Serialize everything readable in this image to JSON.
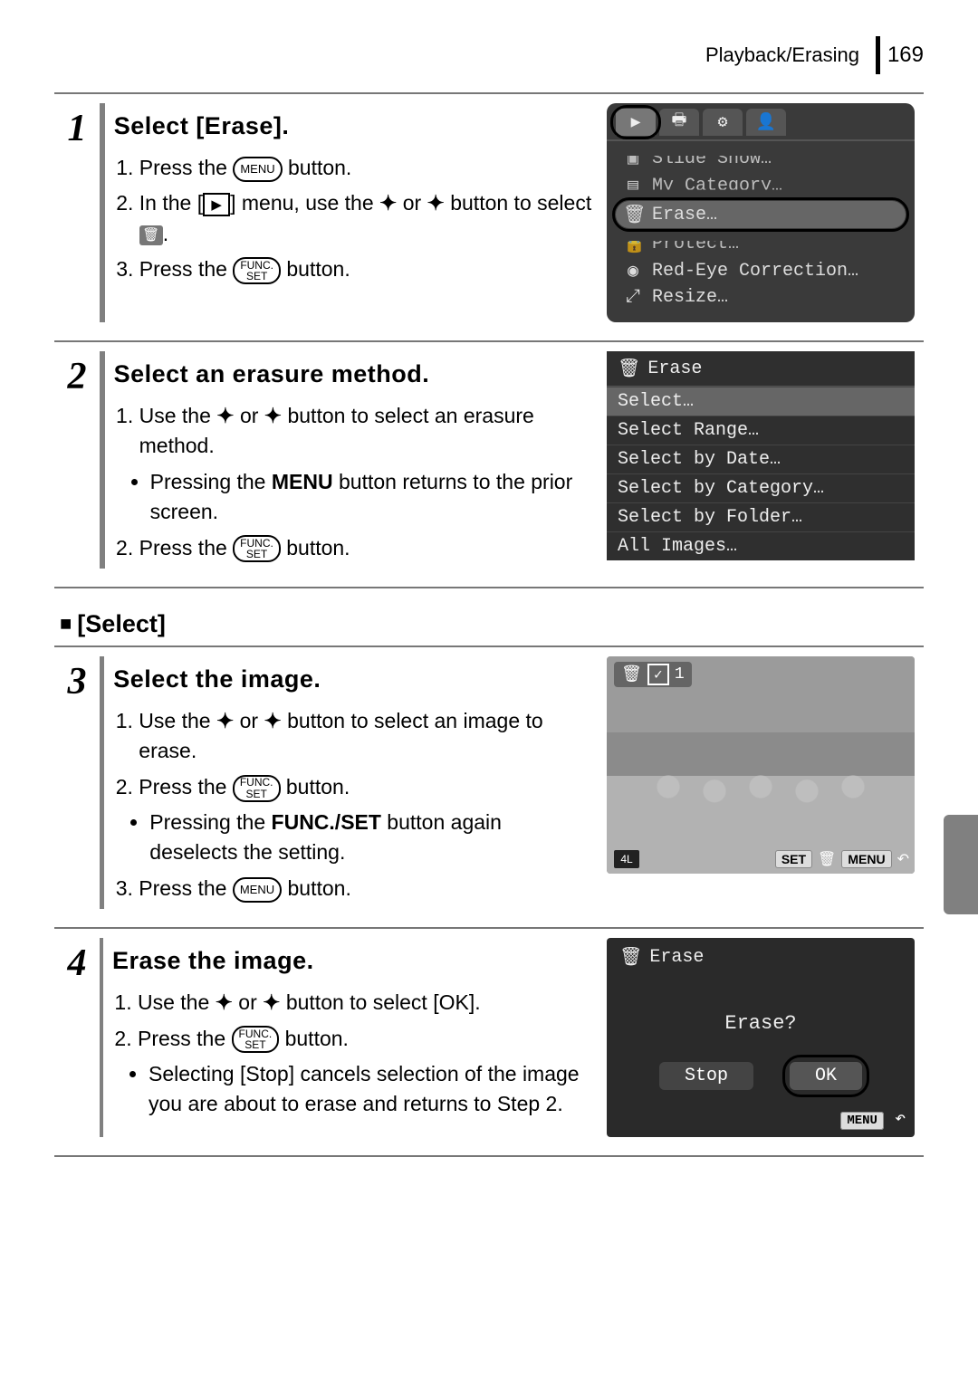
{
  "header": {
    "section": "Playback/Erasing",
    "page": "169"
  },
  "buttons": {
    "menu_label": "MENU",
    "func_top": "FUNC.",
    "func_bottom": "SET"
  },
  "subhead_select": "[Select]",
  "step1": {
    "num": "1",
    "title": "Select [Erase].",
    "li1_a": "Press the ",
    "li1_b": " button.",
    "li2_a": "In the [",
    "li2_b": "] menu, use the ",
    "li2_c": " or ",
    "li2_d": " button to select ",
    "li2_e": ".",
    "li3_a": "Press the ",
    "li3_b": " button.",
    "menu": {
      "item_slide": "Slide Show…",
      "item_mycat": "My Category…",
      "item_erase": "Erase…",
      "item_protect": "Protect…",
      "item_redeye": "Red-Eye Correction…",
      "item_resize": "Resize…"
    }
  },
  "step2": {
    "num": "2",
    "title": "Select an erasure method.",
    "li1_a": "Use the ",
    "li1_b": " or ",
    "li1_c": " button to select an erasure method.",
    "bullet1_a": "Pressing the ",
    "bullet1_b": "MENU",
    "bullet1_c": " button returns to the prior screen.",
    "li2_a": "Press the ",
    "li2_b": " button.",
    "list": {
      "title": "Erase",
      "i1": "Select…",
      "i2": "Select Range…",
      "i3": "Select by Date…",
      "i4": "Select by Category…",
      "i5": "Select by Folder…",
      "i6": "All Images…"
    }
  },
  "step3": {
    "num": "3",
    "title": "Select the image.",
    "li1_a": "Use the ",
    "li1_b": " or ",
    "li1_c": " button to select an image to erase.",
    "li2_a": "Press the ",
    "li2_b": " button.",
    "bullet1_a": "Pressing the ",
    "bullet1_b": "FUNC./SET",
    "bullet1_c": " button again deselects the setting.",
    "li3_a": "Press the ",
    "li3_b": " button.",
    "overlay": {
      "count": "1",
      "size": "4L",
      "set": "SET",
      "menu": "MENU"
    }
  },
  "step4": {
    "num": "4",
    "title": "Erase the image.",
    "li1_a": "Use the ",
    "li1_b": " or ",
    "li1_c": " button to select [OK].",
    "li2_a": "Press the ",
    "li2_b": " button.",
    "bullet1": "Selecting [Stop] cancels selection of the image you are about to erase and returns to Step 2.",
    "confirm": {
      "title": "Erase",
      "q": "Erase?",
      "stop": "Stop",
      "ok": "OK",
      "menu": "MENU"
    }
  }
}
